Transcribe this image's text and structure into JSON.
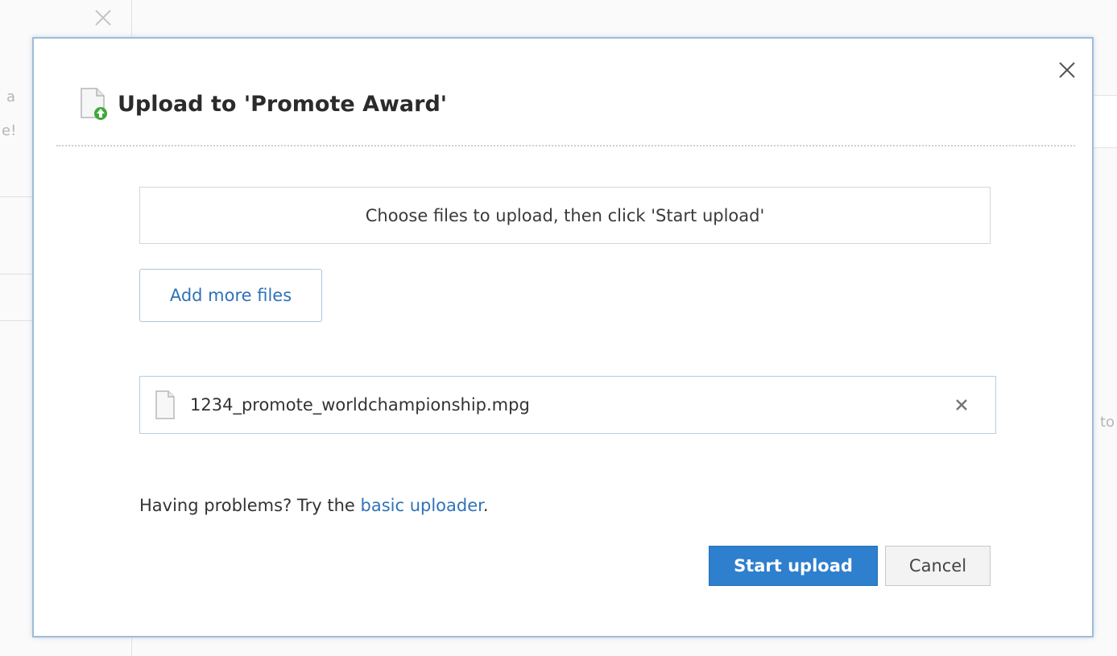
{
  "background": {
    "fragments": [
      "a",
      "e!",
      "to"
    ]
  },
  "dialog": {
    "title": "Upload to 'Promote Award'",
    "instructions": "Choose files to upload, then click 'Start upload'",
    "add_files_label": "Add more files",
    "files": [
      {
        "name": "1234_promote_worldchampionship.mpg"
      }
    ],
    "help": {
      "prefix": "Having problems? Try the ",
      "link_text": "basic uploader",
      "suffix": "."
    },
    "start_label": "Start upload",
    "cancel_label": "Cancel",
    "icons": {
      "title": "file-upload-icon",
      "file": "document-icon",
      "remove": "remove-icon",
      "close": "close-icon"
    },
    "colors": {
      "accent": "#2e7fcd",
      "link": "#2f72b8",
      "modal_border": "#9fbbd9"
    }
  }
}
